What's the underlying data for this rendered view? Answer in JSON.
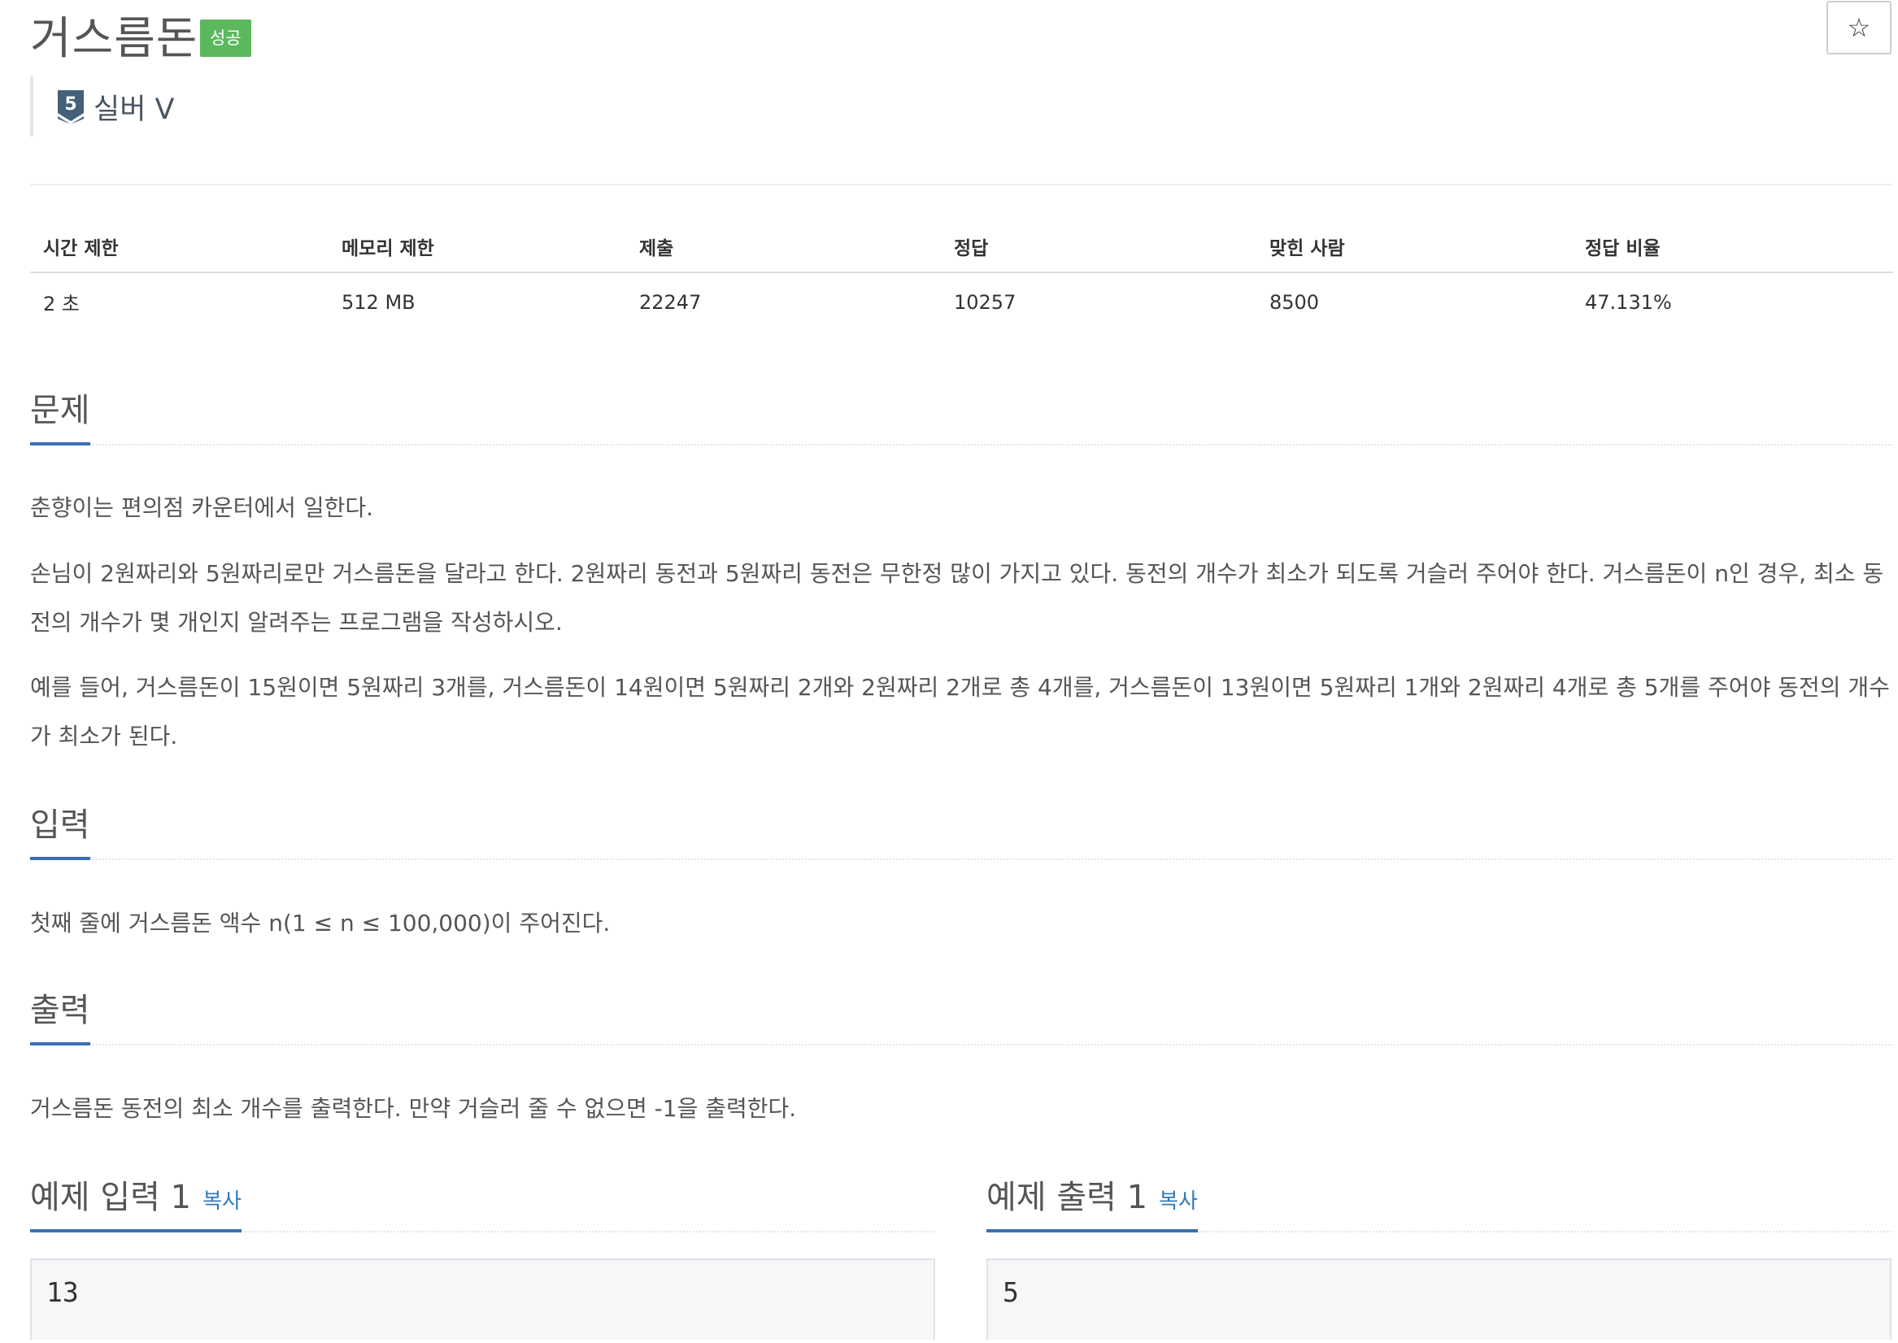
{
  "problem": {
    "title": "거스름돈",
    "status_badge": "성공",
    "star_glyph": "☆",
    "tier": {
      "label": "실버 V",
      "number": "5"
    }
  },
  "stats": {
    "headers": [
      "시간 제한",
      "메모리 제한",
      "제출",
      "정답",
      "맞힌 사람",
      "정답 비율"
    ],
    "values": [
      "2 초",
      "512 MB",
      "22247",
      "10257",
      "8500",
      "47.131%"
    ]
  },
  "sections": {
    "problem": {
      "heading": "문제",
      "paragraphs": [
        "춘향이는 편의점 카운터에서 일한다.",
        "손님이 2원짜리와 5원짜리로만 거스름돈을 달라고 한다. 2원짜리 동전과 5원짜리 동전은 무한정 많이 가지고 있다. 동전의 개수가 최소가 되도록 거슬러 주어야 한다. 거스름돈이 n인 경우, 최소 동전의 개수가 몇 개인지 알려주는 프로그램을 작성하시오.",
        "예를 들어, 거스름돈이 15원이면 5원짜리 3개를, 거스름돈이 14원이면 5원짜리 2개와 2원짜리 2개로 총 4개를, 거스름돈이 13원이면 5원짜리 1개와 2원짜리 4개로 총 5개를 주어야 동전의 개수가 최소가 된다."
      ]
    },
    "input": {
      "heading": "입력",
      "text": "첫째 줄에 거스름돈 액수 n(1 ≤ n ≤ 100,000)이 주어진다."
    },
    "output": {
      "heading": "출력",
      "text": "거스름돈 동전의 최소 개수를 출력한다. 만약 거슬러 줄 수 없으면 -1을 출력한다."
    }
  },
  "samples": {
    "input": {
      "heading": "예제 입력 1",
      "copy_label": "복사",
      "value": "13"
    },
    "output": {
      "heading": "예제 출력 1",
      "copy_label": "복사",
      "value": "5"
    }
  },
  "colors": {
    "badge_success": "#5cb85c",
    "accent_underline": "#3a6fb7",
    "link": "#337ab7",
    "tier_silver": "#435f7a"
  },
  "icons": {
    "star": "star-outline-icon",
    "tier": "silver-tier-shield-icon"
  }
}
